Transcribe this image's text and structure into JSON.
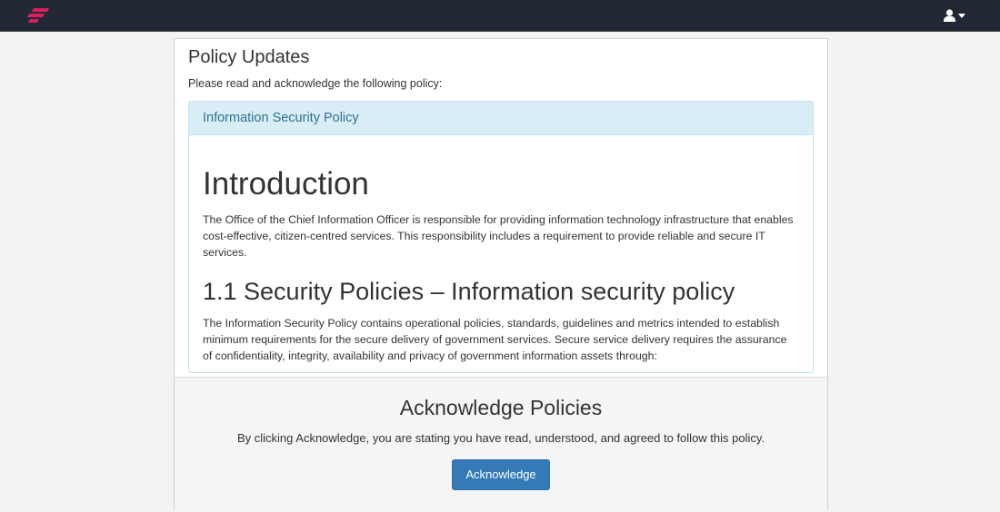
{
  "header": {
    "logo_icon": "brand-logo-icon",
    "user_icon": "user-icon",
    "user_caret_icon": "caret-down-icon",
    "bar_color": "#222833",
    "brand_color": "#d81f5f"
  },
  "page": {
    "title": "Policy Updates",
    "subtitle": "Please read and acknowledge the following policy:"
  },
  "policy": {
    "name": "Information Security Policy",
    "heading": "Introduction",
    "intro_paragraph": "The Office of the Chief Information Officer is responsible for providing information technology infrastructure that enables cost-effective, citizen-centred services. This responsibility includes a requirement to provide reliable and secure IT services.",
    "section_heading": "1.1 Security Policies – Information security policy",
    "section_paragraph": "The Information Security Policy contains operational policies, standards, guidelines and metrics intended to establish minimum requirements for the secure delivery of government services. Secure service delivery requires the assurance of confidentiality, integrity, availability and privacy of government information assets through:"
  },
  "acknowledge": {
    "title": "Acknowledge Policies",
    "text": "By clicking Acknowledge, you are stating you have read, understood, and agreed to follow this policy.",
    "button_label": "Acknowledge",
    "button_color": "#337ab7"
  }
}
